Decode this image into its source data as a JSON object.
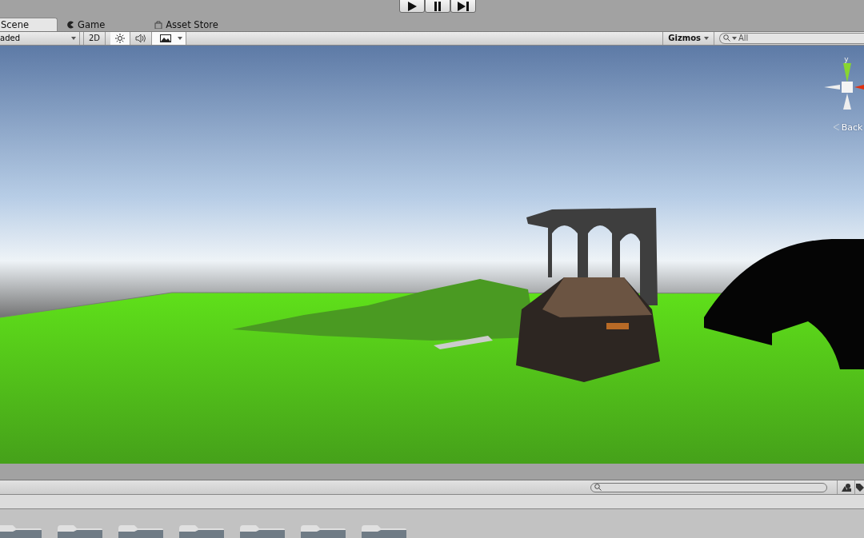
{
  "play_controls": [
    {
      "kind": "play"
    },
    {
      "kind": "pause"
    },
    {
      "kind": "step"
    }
  ],
  "tabs": [
    {
      "kind": "scene",
      "label": "Scene",
      "selected": true
    },
    {
      "kind": "game",
      "label": "Game",
      "selected": false
    },
    {
      "kind": "store",
      "label": "Asset Store",
      "selected": false
    }
  ],
  "scene_toolbar": {
    "draw_mode": "aded",
    "mode_2d": "2D",
    "toggles": [
      {
        "kind": "lighting",
        "on": true
      },
      {
        "kind": "audio",
        "on": false
      },
      {
        "kind": "effects",
        "on": true
      }
    ],
    "gizmos": "Gizmos",
    "search": {
      "placeholder": "All"
    }
  },
  "gizmo": {
    "axis_label": "y",
    "view_label": "Back"
  }
}
